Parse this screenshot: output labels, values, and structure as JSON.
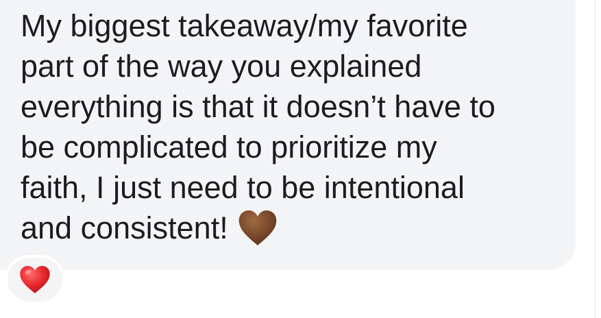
{
  "message": {
    "lines": [
      "My biggest takeaway/my favorite",
      "part of the way you explained",
      "everything is that it doesn’t have to",
      "be complicated to prioritize my",
      "faith, I just need to be intentional",
      "and consistent!"
    ],
    "inline_emoji": "brown-heart-icon"
  },
  "reaction": {
    "emoji": "red-heart-icon"
  },
  "colors": {
    "bubble_background": "#f3f4f6",
    "text": "#1c1c1e",
    "brown_heart": "#7b4a2c",
    "red_heart": "#e8282b"
  }
}
